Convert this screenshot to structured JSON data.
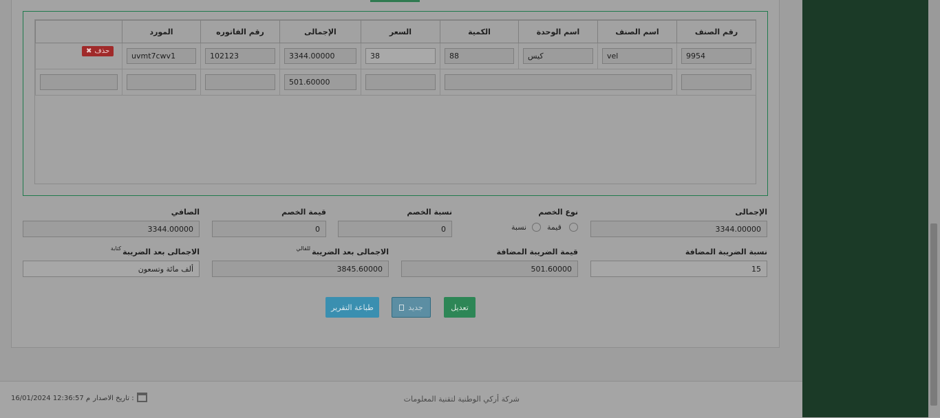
{
  "grid": {
    "headers": [
      "رقم الصنف",
      "اسم الصنف",
      "اسم الوحدة",
      "الكمية",
      "السعر",
      "الإجمالى",
      "رقم الفاتوره",
      "المورد",
      ""
    ],
    "row": {
      "item_no": "9954",
      "item_name": "vel",
      "unit_name": "كيس",
      "quantity": "88",
      "price": "38",
      "total": "3344.00000",
      "invoice_no": "102123",
      "supplier": "uvmt7cwv1",
      "delete_label": "حذف"
    },
    "entry_row": {
      "total": "501.60000"
    }
  },
  "summary": {
    "total_label": "الإجمالى",
    "total_value": "3344.00000",
    "discount_type_label": "نوع الخصم",
    "discount_type_value": "قيمة",
    "discount_type_percent": "نسبة",
    "discount_rate_label": "نسبة الخصم",
    "discount_rate_value": "0",
    "discount_value_label": "قيمة الخصم",
    "discount_value_value": "0",
    "net_label": "الصافي",
    "net_value": "3344.00000",
    "vat_rate_label": "نسبة الضريبة المضافة",
    "vat_rate_value": "15",
    "vat_value_label": "قيمة الضريبة المضافة",
    "vat_value_value": "501.60000",
    "total_after_tax_label": "الاجمالى بعد الضريبة",
    "total_after_tax_sup": "للقالي",
    "total_after_tax_value": "3845.60000",
    "total_after_tax_words_label": "الاجمالى بعد الضريبة",
    "total_after_tax_words_sup": "كتابة",
    "total_after_tax_words_value": "ألف مائة وتسعون"
  },
  "buttons": {
    "edit": "تعديل",
    "new": "جديد",
    "print": "طباعة التقرير"
  },
  "footer": {
    "company": "شركة أركي الوطنية لتقنية المعلومات",
    "release_label": "تاريخ الاصدار :",
    "release_date": "16/01/2024 12:36:57 م"
  },
  "colors": {
    "sidebar": "#1b3a27",
    "accent_green": "#2f8a5a",
    "danger": "#a02a2a",
    "info": "#3a8fb0"
  }
}
